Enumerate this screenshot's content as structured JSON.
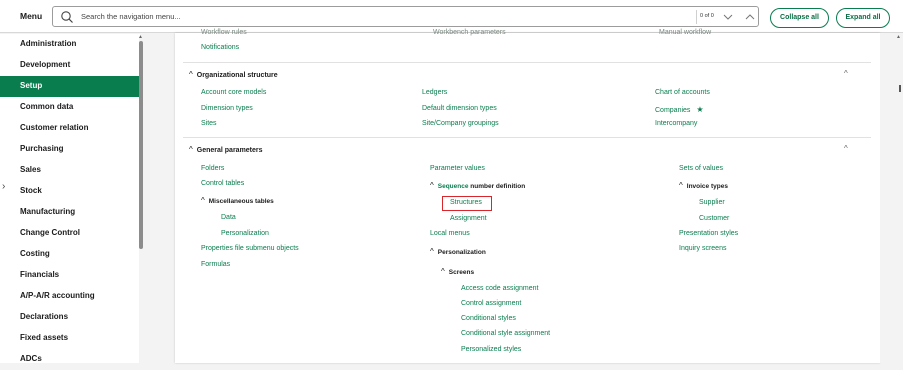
{
  "topbar": {
    "menu_title": "Menu",
    "search_placeholder": "Search the navigation menu...",
    "counter": "0 of 0",
    "collapse_all": "Collapse all",
    "expand_all": "Expand all"
  },
  "sidebar": {
    "items": [
      {
        "label": "Administration"
      },
      {
        "label": "Development"
      },
      {
        "label": "Setup",
        "active": true
      },
      {
        "label": "Common data"
      },
      {
        "label": "Customer relation"
      },
      {
        "label": "Purchasing"
      },
      {
        "label": "Sales"
      },
      {
        "label": "Stock"
      },
      {
        "label": "Manufacturing"
      },
      {
        "label": "Change Control"
      },
      {
        "label": "Costing"
      },
      {
        "label": "Financials"
      },
      {
        "label": "A/P-A/R accounting"
      },
      {
        "label": "Declarations"
      },
      {
        "label": "Fixed assets"
      },
      {
        "label": "ADCs"
      }
    ]
  },
  "main": {
    "cut_row": [
      "Workflow rules",
      "Workbench parameters",
      "Manual workflow"
    ],
    "notifications": "Notifications",
    "org_section": {
      "title": "Organizational structure",
      "col1": [
        "Account core models",
        "Dimension types",
        "Sites"
      ],
      "col2": [
        "Ledgers",
        "Default dimension types",
        "Site/Company groupings"
      ],
      "col3": [
        "Chart of accounts",
        "Companies",
        "Intercompany"
      ]
    },
    "general_section": {
      "title": "General parameters",
      "col1": {
        "links": [
          "Folders",
          "Control tables"
        ],
        "misc_title": "Miscellaneous tables",
        "misc_items": [
          "Data",
          "Personalization"
        ],
        "after": [
          "Properties file submenu objects",
          "Formulas"
        ]
      },
      "col2": {
        "parameter_values": "Parameter values",
        "seq_highlight": "Sequence",
        "seq_rest": " number definition",
        "seq_items": [
          "Structures",
          "Assignment"
        ],
        "local_menus": "Local menus",
        "personalization_title": "Personalization",
        "screens_title": "Screens",
        "screens_items": [
          "Access code assignment",
          "Control assignment",
          "Conditional styles",
          "Conditional style assignment",
          "Personalized styles"
        ]
      },
      "col3": {
        "sets_of_values": "Sets of values",
        "invoice_title": "Invoice types",
        "invoice_items": [
          "Supplier",
          "Customer"
        ],
        "after": [
          "Presentation styles",
          "Inquiry screens"
        ]
      }
    }
  },
  "colors": {
    "accent": "#0a7d4f",
    "highlight_border": "#d9252c"
  }
}
